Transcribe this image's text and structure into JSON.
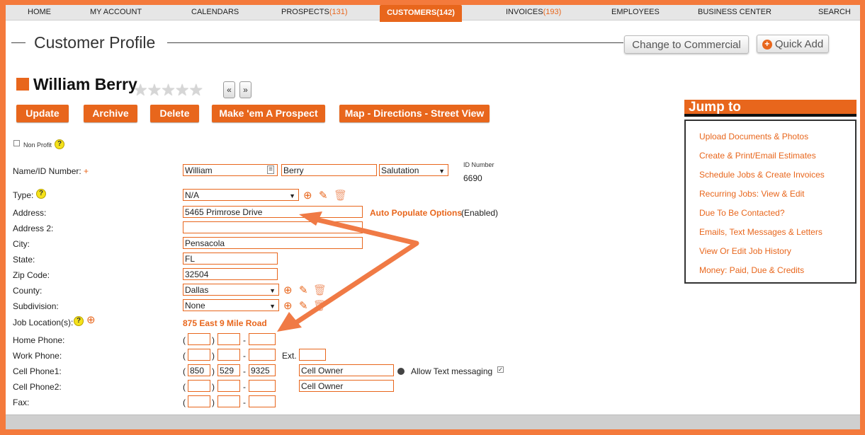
{
  "nav": {
    "home": "HOME",
    "my_account": "MY ACCOUNT",
    "calendars": "CALENDARS",
    "prospects": "PROSPECTS",
    "prospects_count": "(131)",
    "customers": "CUSTOMERS(142)",
    "invoices": "INVOICES",
    "invoices_count": "(193)",
    "employees": "EMPLOYEES",
    "business_center": "BUSINESS CENTER",
    "search": "SEARCH"
  },
  "header": {
    "title": "Customer Profile",
    "change_commercial": "Change to Commercial",
    "quick_add": "Quick Add"
  },
  "customer": {
    "name": "William Berry",
    "stars": "★★★★★",
    "prev": "«",
    "next": "»"
  },
  "actions": {
    "update": "Update",
    "archive": "Archive",
    "delete": "Delete",
    "make_prospect": "Make 'em A Prospect",
    "map": "Map - Directions - Street View"
  },
  "form": {
    "non_profit_label": "Non Profit",
    "name_label": "Name/ID Number:",
    "first_name": "William",
    "last_name": "Berry",
    "salutation": "Salutation",
    "id_number_label": "ID Number",
    "id_number": "6690",
    "type_label": "Type:",
    "type_value": "N/A",
    "address_label": "Address:",
    "address": "5465 Primrose Drive",
    "auto_populate": "Auto Populate Options",
    "auto_populate_status": "(Enabled)",
    "address2_label": "Address 2:",
    "address2": "",
    "city_label": "City:",
    "city": "Pensacola",
    "state_label": "State:",
    "state": "FL",
    "zip_label": "Zip Code:",
    "zip": "32504",
    "county_label": "County:",
    "county": "Dallas",
    "subdivision_label": "Subdivision:",
    "subdivision": "None",
    "job_location_label": "Job Location(s):",
    "job_location": "875 East 9 Mile Road",
    "home_phone_label": "Home Phone:",
    "work_phone_label": "Work Phone:",
    "ext_label": "Ext.",
    "cell1_label": "Cell Phone1:",
    "cell1_area": "850",
    "cell1_prefix": "529",
    "cell1_line": "9325",
    "cell1_owner": "Cell Owner",
    "allow_text": "Allow Text messaging",
    "cell2_label": "Cell Phone2:",
    "cell2_owner": "Cell Owner",
    "fax_label": "Fax:",
    "paren_open": "(",
    "paren_close": ")",
    "dash": "-"
  },
  "jump": {
    "title": "Jump to",
    "items": [
      "Upload Documents & Photos",
      "Create & Print/Email Estimates",
      "Schedule Jobs & Create Invoices",
      "Recurring Jobs: View & Edit",
      "Due To Be Contacted?",
      "Emails, Text Messages & Letters",
      "View Or Edit Job History",
      "Money: Paid, Due & Credits"
    ]
  },
  "icons": {
    "add": "add-document-icon",
    "edit": "pencil-icon",
    "trash": "trash-icon",
    "help": "help-icon",
    "contact_card": "contact-card-icon"
  },
  "colors": {
    "accent": "#e8661c",
    "frame": "#f47a3c",
    "annotation_arrow": "#f07a45"
  }
}
